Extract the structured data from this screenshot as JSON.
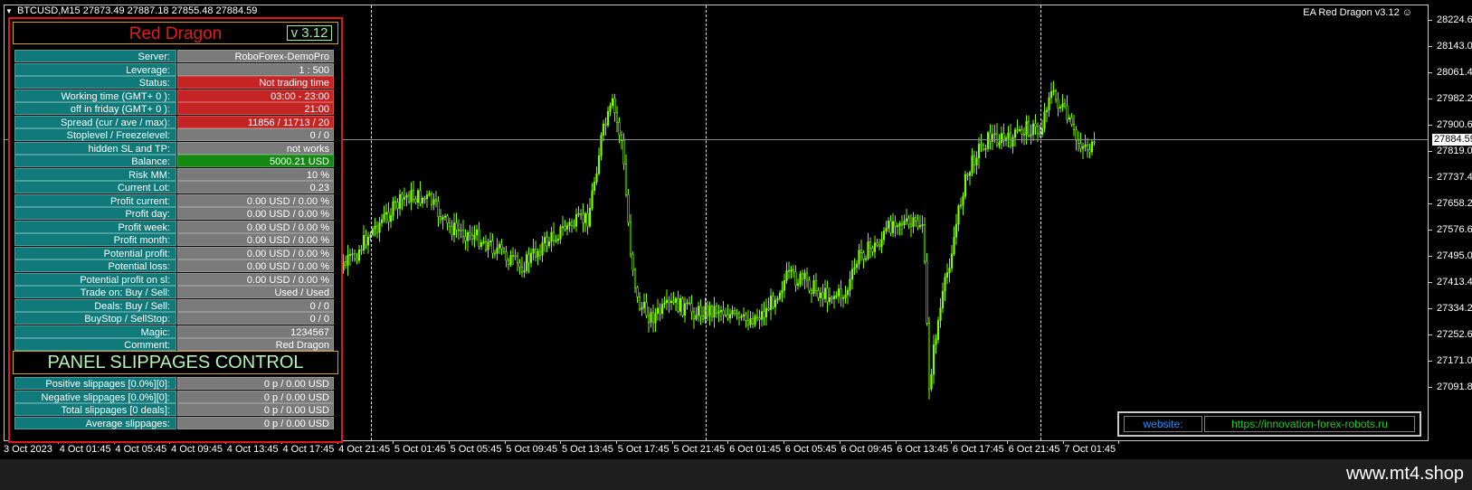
{
  "chart": {
    "symbol_header": "BTCUSD,M15  27873.49 27887.18 27855.48 27884.59",
    "ea_label": "EA Red Dragon v3.12",
    "ea_label_icon": "smiley-icon",
    "current_price": "27884.59",
    "price_axis": [
      "28224.60",
      "28143.00",
      "28061.40",
      "27982.20",
      "27900.60",
      "27819.00",
      "27737.40",
      "27658.20",
      "27576.60",
      "27495.00",
      "27413.40",
      "27334.20",
      "27252.60",
      "27171.00",
      "27091.80"
    ],
    "time_axis": [
      "3 Oct 2023",
      "4 Oct 01:45",
      "4 Oct 05:45",
      "4 Oct 09:45",
      "4 Oct 13:45",
      "4 Oct 17:45",
      "4 Oct 21:45",
      "5 Oct 01:45",
      "5 Oct 05:45",
      "5 Oct 09:45",
      "5 Oct 13:45",
      "5 Oct 17:45",
      "5 Oct 21:45",
      "6 Oct 01:45",
      "6 Oct 05:45",
      "6 Oct 09:45",
      "6 Oct 13:45",
      "6 Oct 17:45",
      "6 Oct 21:45",
      "7 Oct 01:45"
    ],
    "candle_color": "#7cfc00",
    "background_color": "#000000"
  },
  "panel": {
    "name": "Red Dragon",
    "version": "v 3.12",
    "rows": [
      {
        "label": "Server:",
        "value": "RoboForex-DemoPro",
        "style": "normal"
      },
      {
        "label": "Leverage:",
        "value": "1 : 500",
        "style": "normal"
      },
      {
        "label": "Status:",
        "value": "Not trading time",
        "style": "red"
      },
      {
        "label": "Working time (GMT+ 0 ):",
        "value": "03:00 - 23:00",
        "style": "red"
      },
      {
        "label": "off in friday (GMT+ 0 ):",
        "value": "21:00",
        "style": "red"
      },
      {
        "label": "Spread (cur / ave / max):",
        "value": "11856 / 11713 / 20",
        "style": "red"
      },
      {
        "label": "Stoplevel  /  Freezelevel:",
        "value": "0  /  0",
        "style": "normal"
      },
      {
        "label": "hidden SL and TP:",
        "value": "not works",
        "style": "normal"
      },
      {
        "label": "Balance:",
        "value": "5000.21 USD",
        "style": "green"
      },
      {
        "label": "Risk MM:",
        "value": "10 %",
        "style": "normal"
      },
      {
        "label": "Current Lot:",
        "value": "0.23",
        "style": "normal"
      },
      {
        "label": "Profit current:",
        "value": "0.00 USD / 0.00 %",
        "style": "normal"
      },
      {
        "label": "Profit day:",
        "value": "0.00 USD / 0.00 %",
        "style": "normal"
      },
      {
        "label": "Profit week:",
        "value": "0.00 USD / 0.00 %",
        "style": "normal"
      },
      {
        "label": "Profit month:",
        "value": "0.00 USD / 0.00 %",
        "style": "normal"
      },
      {
        "label": "Potential profit:",
        "value": "0.00 USD / 0.00 %",
        "style": "normal"
      },
      {
        "label": "Potential loss:",
        "value": "0.00 USD / 0.00 %",
        "style": "normal"
      },
      {
        "label": "Potential profit on sl:",
        "value": "0.00 USD / 0.00 %",
        "style": "normal"
      },
      {
        "label": "Trade on: Buy  /  Sell:",
        "value": "Used  /  Used",
        "style": "normal"
      },
      {
        "label": "Deals: Buy / Sell:",
        "value": "0  /  0",
        "style": "normal"
      },
      {
        "label": "BuyStop / SellStop:",
        "value": "0  /  0",
        "style": "normal"
      },
      {
        "label": "Magic:",
        "value": "1234567",
        "style": "normal"
      },
      {
        "label": "Comment:",
        "value": "Red Dragon",
        "style": "normal"
      }
    ],
    "slippage_title": "PANEL SLIPPAGES CONTROL",
    "slippage_rows": [
      {
        "label": "Positive slippages [0.0%][0]:",
        "value": "0 p / 0.00 USD"
      },
      {
        "label": "Negative slippages [0.0%][0]:",
        "value": "0 p / 0.00 USD"
      },
      {
        "label": "Total slippages [0 deals]:",
        "value": "0 p / 0.00 USD"
      },
      {
        "label": "Average slippages:",
        "value": "0 p / 0.00 USD"
      }
    ],
    "colors": {
      "border": "#e11818",
      "label_bg": "#107a7a",
      "value_bg": "#7a7a7a",
      "alert_bg": "#c42424",
      "balance_bg": "#128a12"
    }
  },
  "website": {
    "label": "website:",
    "url": "https://innovation-forex-robots.ru"
  },
  "watermark": "www.mt4.shop"
}
